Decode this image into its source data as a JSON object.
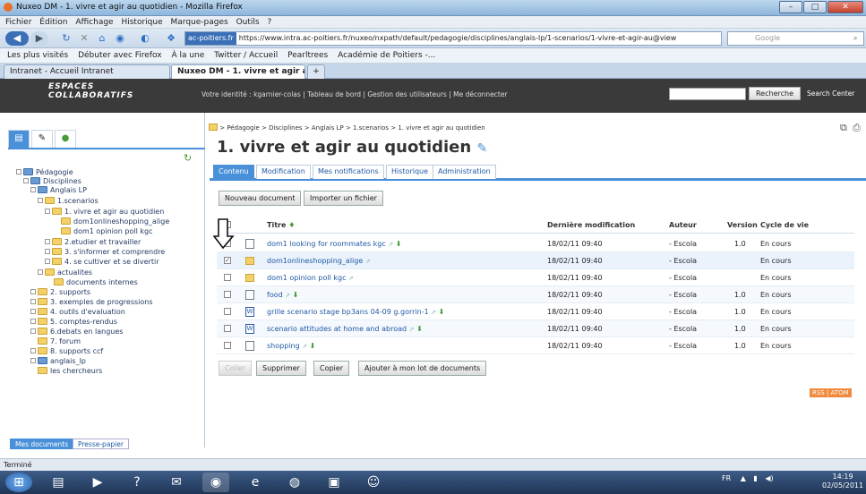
{
  "browser": {
    "window_title": "Nuxeo DM - 1. vivre et agir au quotidien - Mozilla Firefox",
    "menu": [
      "Fichier",
      "Édition",
      "Affichage",
      "Historique",
      "Marque-pages",
      "Outils",
      "?"
    ],
    "url_site": "ac-poitiers.fr",
    "url": "https://www.intra.ac-poitiers.fr/nuxeo/nxpath/default/pedagogie/disciplines/anglais-lp/1-scenarios/1-vivre-et-agir-au@view",
    "search_placeholder": "Google",
    "bookmarks": [
      "Les plus visités",
      "Débuter avec Firefox",
      "À la une",
      "Twitter / Accueil",
      "Pearltrees",
      "Académie de Poitiers -..."
    ],
    "tabs": [
      "Intranet - Accueil Intranet",
      "Nuxeo DM - 1. vivre et agir au qu..."
    ],
    "status": "Terminé"
  },
  "app": {
    "logo_line1": "ESPACES",
    "logo_line2": "COLLABORATIFS",
    "identity": "Votre identité : kgarnier-colas | Tableau de bord | Gestion des utilisateurs | Me déconnecter",
    "search_button": "Recherche",
    "search_center": "Search Center"
  },
  "tree": [
    {
      "label": "Pédagogie"
    },
    {
      "label": "Disciplines"
    },
    {
      "label": "Anglais LP"
    },
    {
      "label": "1.scenarios"
    },
    {
      "label": "1. vivre et agir au quotidien"
    },
    {
      "label": "dom1onlineshopping_alige"
    },
    {
      "label": "dom1 opinion poll kgc"
    },
    {
      "label": "2.etudier et travailler"
    },
    {
      "label": "3. s'informer et comprendre"
    },
    {
      "label": "4. se cultiver et se divertir"
    },
    {
      "label": "actualites"
    },
    {
      "label": "documents internes"
    },
    {
      "label": "2. supports"
    },
    {
      "label": "3. exemples de progressions"
    },
    {
      "label": "4. outils d'evaluation"
    },
    {
      "label": "5. comptes-rendus"
    },
    {
      "label": "6.debats en langues"
    },
    {
      "label": "7. forum"
    },
    {
      "label": "8. supports ccf"
    },
    {
      "label": "anglais_lp"
    },
    {
      "label": "les chercheurs"
    }
  ],
  "sidebar_bottom_tabs": [
    "Mes documents",
    "Presse-papier"
  ],
  "breadcrumb": "> Pédagogie > Disciplines > Anglais LP > 1.scenarios > 1. vivre et agir au quotidien",
  "page_title": "1. vivre et agir au quotidien",
  "main_tabs": [
    "Contenu",
    "Modification",
    "Mes notifications",
    "Historique",
    "Administration"
  ],
  "actions_top": [
    "Nouveau document",
    "Importer un fichier"
  ],
  "table": {
    "headers": {
      "title": "Titre",
      "modified": "Dernière modification",
      "author": "Auteur",
      "version": "Version",
      "lifecycle": "Cycle de vie"
    },
    "rows": [
      {
        "title": "dom1 looking for roommates kgc",
        "modified": "18/02/11 09:40",
        "author": "- Escola",
        "version": "1.0",
        "lifecycle": "En cours",
        "checked": false,
        "icon": "document-icon"
      },
      {
        "title": "dom1onlineshopping_alige",
        "modified": "18/02/11 09:40",
        "author": "- Escola",
        "version": "",
        "lifecycle": "En cours",
        "checked": true,
        "icon": "folder-icon"
      },
      {
        "title": "dom1 opinion poll kgc",
        "modified": "18/02/11 09:40",
        "author": "- Escola",
        "version": "",
        "lifecycle": "En cours",
        "checked": false,
        "icon": "folder-icon"
      },
      {
        "title": "food",
        "modified": "18/02/11 09:40",
        "author": "- Escola",
        "version": "1.0",
        "lifecycle": "En cours",
        "checked": false,
        "icon": "document-icon"
      },
      {
        "title": "grille scenario stage bp3ans 04-09 g.gorrin-1",
        "modified": "18/02/11 09:40",
        "author": "- Escola",
        "version": "1.0",
        "lifecycle": "En cours",
        "checked": false,
        "icon": "word-icon"
      },
      {
        "title": "scenario attitudes at home and abroad",
        "modified": "18/02/11 09:40",
        "author": "- Escola",
        "version": "1.0",
        "lifecycle": "En cours",
        "checked": false,
        "icon": "word-icon"
      },
      {
        "title": "shopping",
        "modified": "18/02/11 09:40",
        "author": "- Escola",
        "version": "1.0",
        "lifecycle": "En cours",
        "checked": false,
        "icon": "document-icon"
      }
    ]
  },
  "actions_bottom": [
    "Coller",
    "Supprimer",
    "Copier",
    "Ajouter à mon lot de documents"
  ],
  "rss_atom": "RSS | ATOM",
  "system": {
    "lang": "FR",
    "time": "14:19",
    "date": "02/05/2011"
  }
}
